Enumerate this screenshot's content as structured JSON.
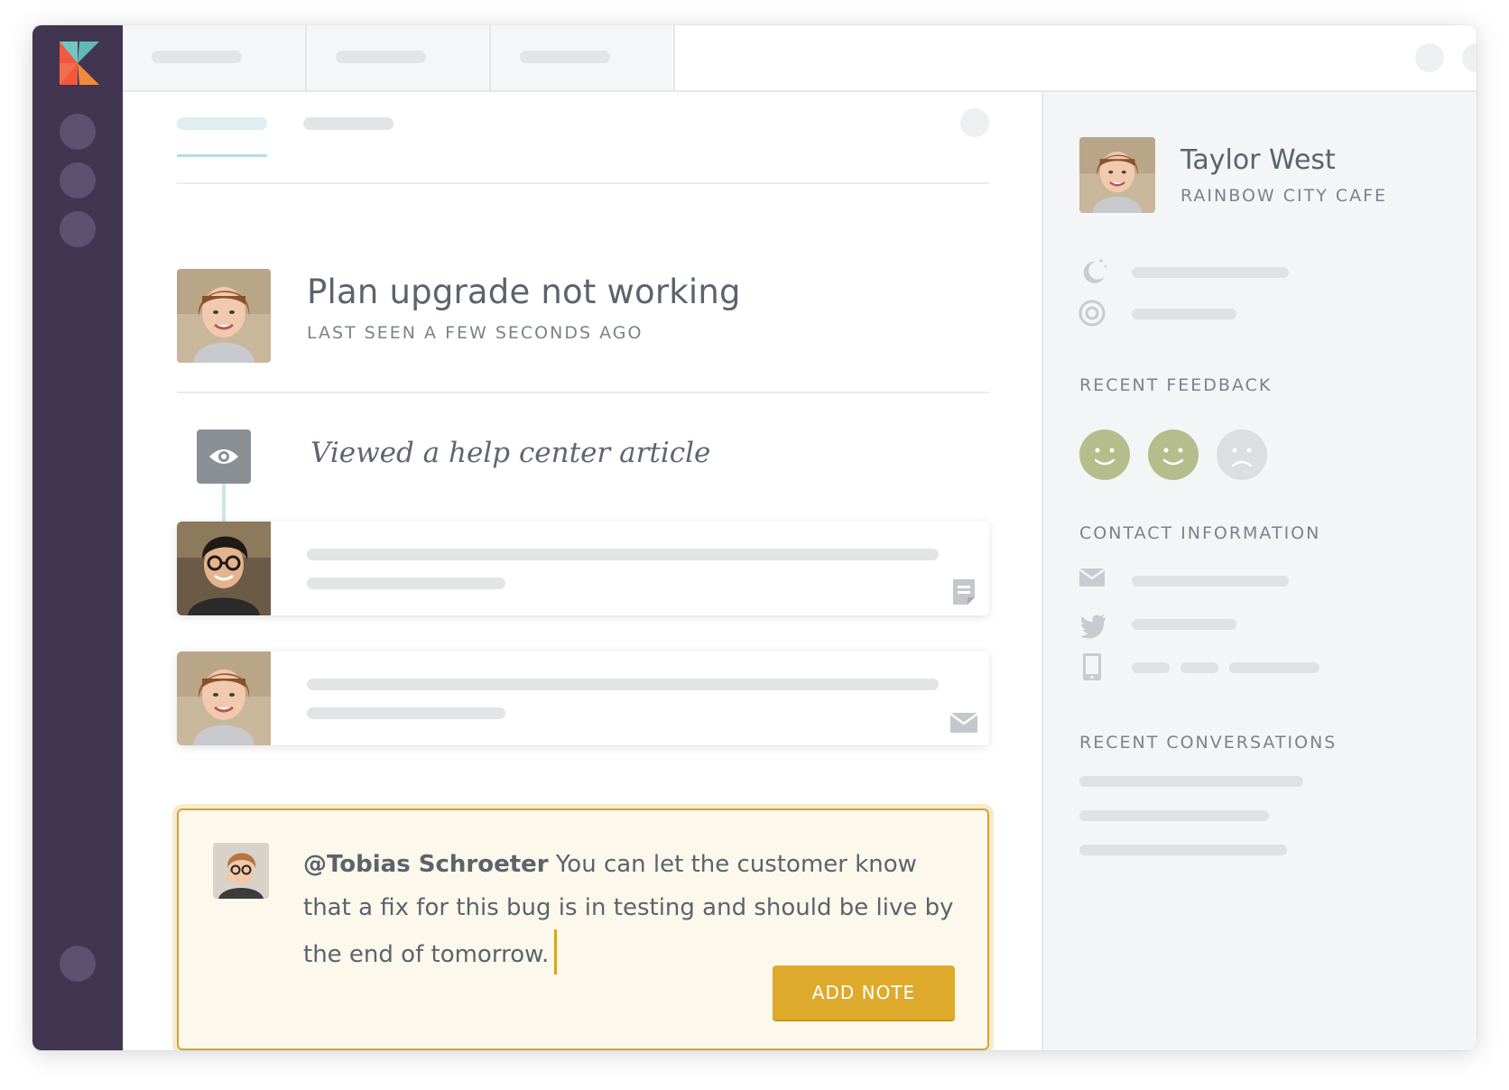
{
  "app": {
    "logo_name": "kayako-logo"
  },
  "conversation": {
    "title": "Plan upgrade not working",
    "subtitle": "LAST SEEN A FEW SECONDS AGO",
    "event_label": "Viewed a help center article",
    "event_icon": "eye-icon"
  },
  "timeline": [
    {
      "type": "article",
      "icon": "document-icon"
    },
    {
      "type": "email",
      "icon": "envelope-icon"
    }
  ],
  "note": {
    "mention": "@Tobias Schroeter",
    "text": " You can let the customer know that a fix for this bug is in testing and should be live by the end of tomorrow.",
    "button_label": "ADD NOTE"
  },
  "customer": {
    "name": "Taylor West",
    "company": "RAINBOW CITY CAFE",
    "meta_icons": [
      "moon-icon",
      "target-icon"
    ]
  },
  "sections": {
    "recent_feedback": "RECENT FEEDBACK",
    "contact_information": "CONTACT INFORMATION",
    "recent_conversations": "RECENT CONVERSATIONS"
  },
  "feedback": [
    "positive",
    "positive",
    "negative"
  ],
  "contact_icons": [
    "envelope-icon",
    "twitter-icon",
    "phone-icon"
  ],
  "colors": {
    "rail": "#413552",
    "accent": "#ddaa2b",
    "feedback_positive": "#b6bd8d",
    "feedback_negative": "#dcdee0"
  }
}
